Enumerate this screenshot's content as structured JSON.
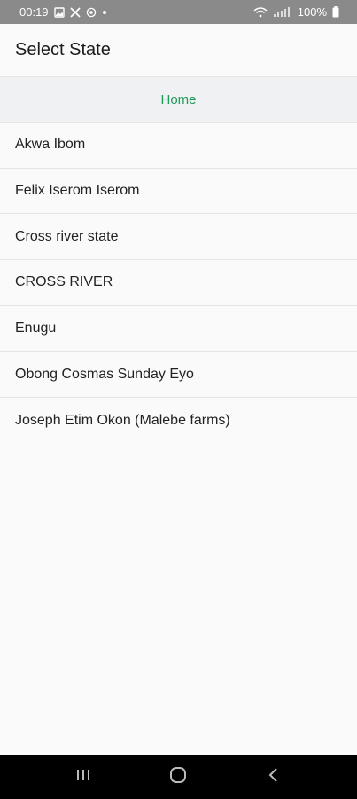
{
  "status_bar": {
    "time": "00:19",
    "battery": "100%",
    "left_icons": [
      "gallery-icon",
      "x-app-icon",
      "whatsapp-icon",
      "dot-icon"
    ],
    "right_icons": [
      "wifi-icon",
      "signal-icon",
      "battery-icon"
    ]
  },
  "app_bar": {
    "title": "Select State"
  },
  "home_link": {
    "label": "Home",
    "color": "#1f9a58"
  },
  "list": {
    "items": [
      {
        "label": "Akwa Ibom"
      },
      {
        "label": "Felix Iserom Iserom"
      },
      {
        "label": "Cross river state"
      },
      {
        "label": "CROSS RIVER"
      },
      {
        "label": "Enugu"
      },
      {
        "label": "Obong Cosmas Sunday Eyo"
      },
      {
        "label": "Joseph Etim Okon (Malebe farms)"
      }
    ]
  },
  "nav_bar": {
    "buttons": [
      "recents-icon",
      "home-circle-icon",
      "back-icon"
    ]
  }
}
